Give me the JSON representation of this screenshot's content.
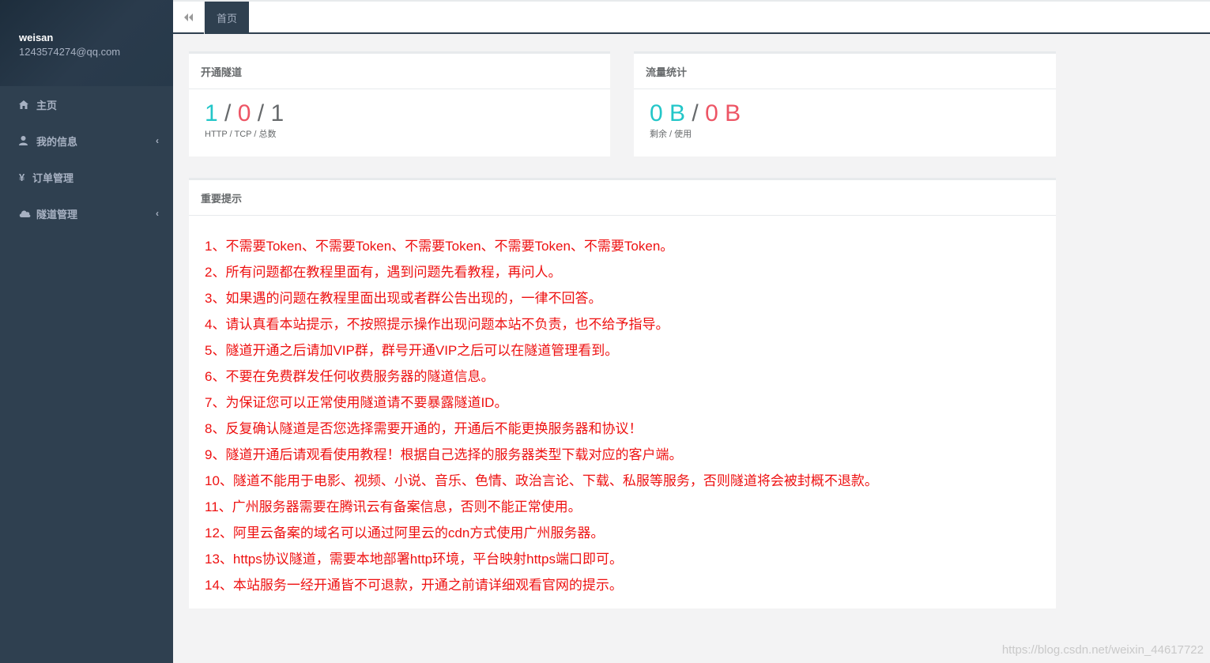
{
  "user": {
    "name": "weisan",
    "email": "1243574274@qq.com"
  },
  "sidebar": {
    "items": [
      {
        "label": "主页",
        "icon": "home-icon",
        "has_arrow": false
      },
      {
        "label": "我的信息",
        "icon": "user-icon",
        "has_arrow": true
      },
      {
        "label": "订单管理",
        "icon": "yen-icon",
        "has_arrow": false
      },
      {
        "label": "隧道管理",
        "icon": "cloud-icon",
        "has_arrow": true
      }
    ],
    "arrow": "‹",
    "yen_glyph": "¥"
  },
  "tabs": {
    "back_icon": "double-left-icon",
    "home_label": "首页"
  },
  "tunnels": {
    "title": "开通隧道",
    "http": "1",
    "sep1": "/",
    "tcp": "0",
    "sep2": "/",
    "total": "1",
    "sub": "HTTP / TCP / 总数"
  },
  "traffic": {
    "title": "流量统计",
    "remaining": "0 B",
    "sep": "/",
    "used": "0 B",
    "sub": "剩余 / 使用"
  },
  "notice": {
    "title": "重要提示",
    "items": [
      "1、不需要Token、不需要Token、不需要Token、不需要Token、不需要Token。",
      "2、所有问题都在教程里面有，遇到问题先看教程，再问人。",
      "3、如果遇的问题在教程里面出现或者群公告出现的，一律不回答。",
      "4、请认真看本站提示，不按照提示操作出现问题本站不负责，也不给予指导。",
      "5、隧道开通之后请加VIP群，群号开通VIP之后可以在隧道管理看到。",
      "6、不要在免费群发任何收费服务器的隧道信息。",
      "7、为保证您可以正常使用隧道请不要暴露隧道ID。",
      "8、反复确认隧道是否您选择需要开通的，开通后不能更换服务器和协议！",
      "9、隧道开通后请观看使用教程！根据自己选择的服务器类型下载对应的客户端。",
      "10、隧道不能用于电影、视频、小说、音乐、色情、政治言论、下载、私服等服务，否则隧道将会被封概不退款。",
      "11、广州服务器需要在腾讯云有备案信息，否则不能正常使用。",
      "12、阿里云备案的域名可以通过阿里云的cdn方式使用广州服务器。",
      "13、https协议隧道，需要本地部署http环境，平台映射https端口即可。",
      "14、本站服务一经开通皆不可退款，开通之前请详细观看官网的提示。"
    ]
  },
  "watermark": "https://blog.csdn.net/weixin_44617722",
  "colors": {
    "sidebar": "#2f4050",
    "teal": "#23c6c8",
    "red": "#ed5565",
    "notice_text": "#ee1111"
  }
}
